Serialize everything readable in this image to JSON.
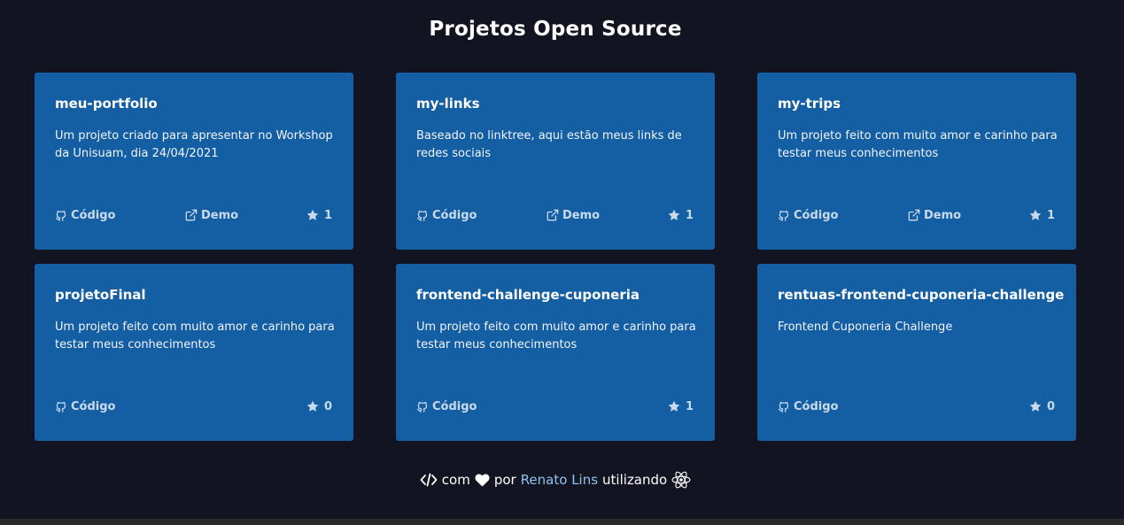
{
  "section": {
    "title": "Projetos Open Source"
  },
  "projects": [
    {
      "name": "meu-portfolio",
      "description": "Um projeto criado para apresentar no Workshop da Unisuam, dia 24/04/2021",
      "code_label": "Código",
      "demo_label": "Demo",
      "stars": "1"
    },
    {
      "name": "my-links",
      "description": "Baseado no linktree, aqui estão meus links de redes sociais",
      "code_label": "Código",
      "demo_label": "Demo",
      "stars": "1"
    },
    {
      "name": "my-trips",
      "description": "Um projeto feito com muito amor e carinho para testar meus conhecimentos",
      "code_label": "Código",
      "demo_label": "Demo",
      "stars": "1"
    },
    {
      "name": "projetoFinal",
      "description": "Um projeto feito com muito amor e carinho para testar meus conhecimentos",
      "code_label": "Código",
      "stars": "0"
    },
    {
      "name": "frontend-challenge-cuponeria",
      "description": "Um projeto feito com muito amor e carinho para testar meus conhecimentos",
      "code_label": "Código",
      "stars": "1"
    },
    {
      "name": "rentuas-frontend-cuponeria-challenge",
      "description": "Frontend Cuponeria Challenge",
      "code_label": "Código",
      "stars": "0"
    }
  ],
  "footer": {
    "with": "com",
    "by": "por",
    "author": "Renato Lins",
    "using": "utilizando"
  },
  "icons": {
    "code": "code-icon",
    "heart": "heart-icon",
    "react": "react-icon",
    "github": "github-icon",
    "external": "external-link-icon",
    "star": "star-icon"
  },
  "colors": {
    "background": "#131421",
    "card": "#145ea3",
    "link": "#8fc4ef"
  }
}
